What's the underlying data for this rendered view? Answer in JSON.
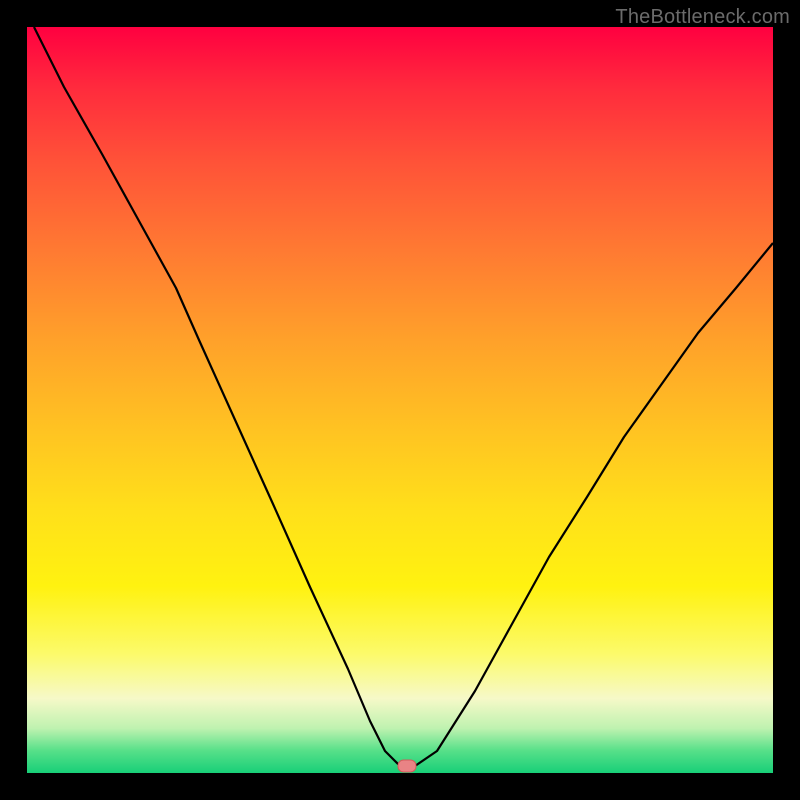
{
  "watermark": "TheBottleneck.com",
  "colors": {
    "frame": "#000000",
    "curve": "#000000",
    "marker_fill": "#e98385",
    "marker_border": "#d45a5a",
    "watermark": "#6b6b6b",
    "gradient_stops": [
      "#ff0040",
      "#ff2a3d",
      "#ff5238",
      "#ff7a32",
      "#ffa12a",
      "#ffc322",
      "#ffe01a",
      "#fff210",
      "#fcfa6a",
      "#f6f9c8",
      "#bff2b0",
      "#57e089",
      "#18cf78"
    ]
  },
  "chart_data": {
    "type": "line",
    "title": "",
    "xlabel": "",
    "ylabel": "",
    "xlim": [
      0,
      100
    ],
    "ylim": [
      0,
      100
    ],
    "grid": false,
    "legend": false,
    "series": [
      {
        "name": "bottleneck-curve",
        "x": [
          1,
          5,
          10,
          15,
          20,
          23,
          28,
          33,
          38,
          43,
          46,
          48,
          50,
          52,
          55,
          60,
          65,
          70,
          75,
          80,
          85,
          90,
          95,
          100
        ],
        "y": [
          100,
          92,
          83,
          74,
          65,
          58,
          47,
          36,
          25,
          14,
          7,
          3,
          1,
          1,
          3,
          11,
          20,
          29,
          37,
          45,
          52,
          59,
          65,
          71
        ]
      }
    ],
    "marker": {
      "x": 51,
      "y": 1,
      "shape": "pill"
    },
    "notes": "y-axis reads as bottleneck percentage (0 at bottom / green, 100 at top / red); x-axis is an unlabeled parameter sweep. Curve shows a V-shaped dip reaching ~1% near x≈51 then rising again; right branch tops out near y≈71 at x=100."
  }
}
